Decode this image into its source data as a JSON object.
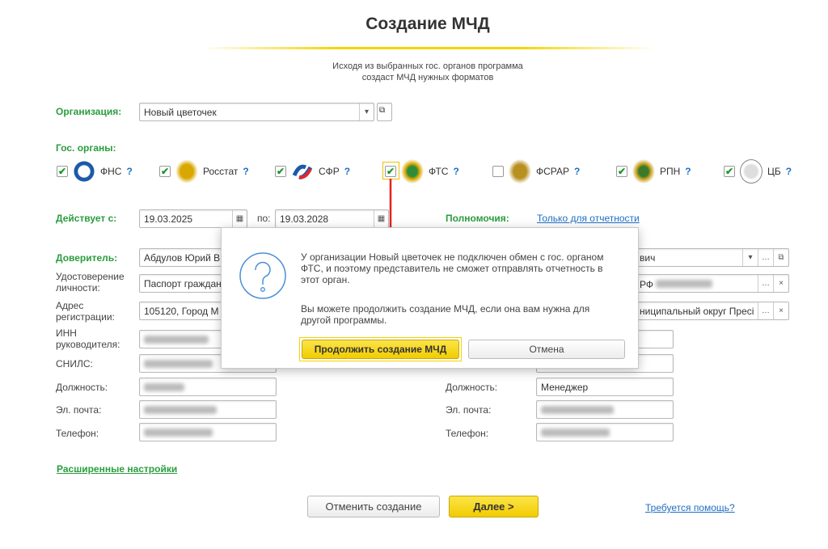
{
  "header": {
    "title": "Создание МЧД",
    "subtitle_line1": "Исходя из выбранных гос. органов программа",
    "subtitle_line2": "создаст МЧД нужных форматов"
  },
  "organization": {
    "label": "Организация:",
    "value": "Новый цветочек"
  },
  "gov_bodies": {
    "label": "Гос. органы:",
    "items": [
      {
        "name": "ФНС",
        "checked": true,
        "help": "?"
      },
      {
        "name": "Росстат",
        "checked": true,
        "help": "?"
      },
      {
        "name": "СФР",
        "checked": true,
        "help": "?"
      },
      {
        "name": "ФТС",
        "checked": true,
        "help": "?"
      },
      {
        "name": "ФСРАР",
        "checked": false,
        "help": "?"
      },
      {
        "name": "РПН",
        "checked": true,
        "help": "?"
      },
      {
        "name": "ЦБ",
        "checked": true,
        "help": "?"
      }
    ]
  },
  "validity": {
    "label": "Действует с:",
    "from": "19.03.2025",
    "to_label": "по:",
    "to": "19.03.2028"
  },
  "powers": {
    "label": "Полномочия:",
    "value": "Только для отчетности"
  },
  "principal": {
    "label": "Доверитель:",
    "value": "Абдулов Юрий В",
    "id_label": "Удостоверение личности:",
    "id_value": "Паспорт граждан",
    "address_label": "Адрес регистрации:",
    "address_value": "105120, Город М",
    "inn_label": "ИНН руководителя:",
    "snils_label": "СНИЛС:",
    "position_label": "Должность:",
    "email_label": "Эл. почта:",
    "phone_label": "Телефон:"
  },
  "representative": {
    "name_value": "вич",
    "id_value": "РФ",
    "address_value": "ниципальный округ Пресі",
    "position_label": "Должность:",
    "position_value": "Менеджер",
    "email_label": "Эл. почта:",
    "phone_label": "Телефон:"
  },
  "dialog": {
    "message1": "У организации Новый цветочек не подключен обмен с гос. органом ФТС, и поэтому представитель не сможет отправлять отчетность в этот орган.",
    "message2": "Вы можете продолжить создание МЧД, если она вам нужна для другой программы.",
    "continue_label": "Продолжить создание МЧД",
    "cancel_label": "Отмена"
  },
  "footer": {
    "advanced_label": "Расширенные настройки",
    "cancel_label": "Отменить создание",
    "next_label": "Далее >",
    "help_label": "Требуется помощь?"
  },
  "colors": {
    "accent_green": "#2a9d3e",
    "accent_yellow": "#f5d400",
    "link": "#1f6ec2",
    "arrow": "#e8201c"
  }
}
